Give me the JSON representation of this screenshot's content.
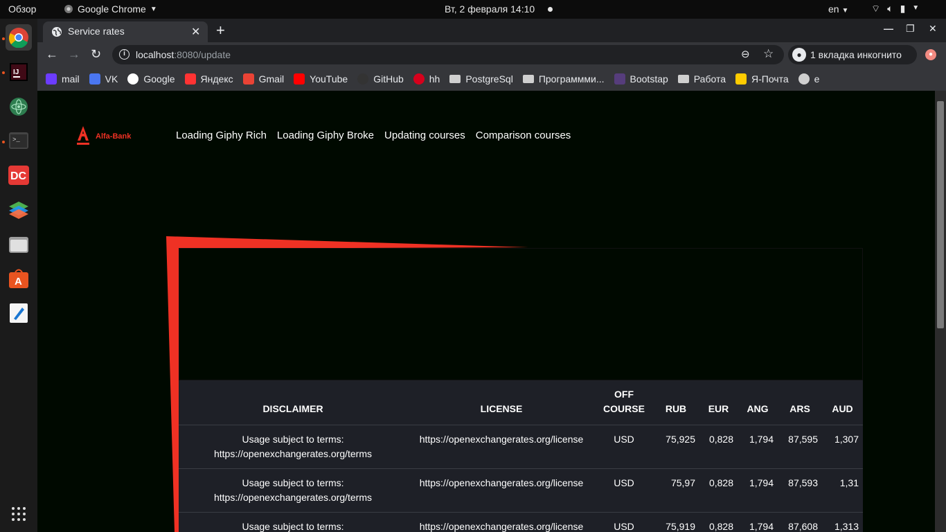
{
  "os": {
    "overview": "Обзор",
    "app_name": "Google Chrome",
    "clock": "Вт, 2 февраля  14:10",
    "lang": "en"
  },
  "browser": {
    "tab_title": "Service rates",
    "url_host": "localhost",
    "url_rest": ":8080/update",
    "incognito_label": "1 вкладка инкогнито",
    "bookmarks": [
      {
        "label": "mail",
        "icon": "at-icon",
        "color": "#6c3cff"
      },
      {
        "label": "VK",
        "icon": "vk-icon",
        "color": "#4a76f0"
      },
      {
        "label": "Google",
        "icon": "google-icon",
        "color": "#ffffff"
      },
      {
        "label": "Яндекс",
        "icon": "yandex-icon",
        "color": "#f33"
      },
      {
        "label": "Gmail",
        "icon": "gmail-icon",
        "color": "#ea4335"
      },
      {
        "label": "YouTube",
        "icon": "youtube-icon",
        "color": "#ff0000"
      },
      {
        "label": "GitHub",
        "icon": "github-icon",
        "color": "#333"
      },
      {
        "label": "hh",
        "icon": "hh-icon",
        "color": "#d6001c"
      },
      {
        "label": "PostgreSql",
        "icon": "folder-icon",
        "color": "#cfcfcf"
      },
      {
        "label": "Программми...",
        "icon": "folder-icon",
        "color": "#cfcfcf"
      },
      {
        "label": "Bootstap",
        "icon": "bootstrap-icon",
        "color": "#563d7c"
      },
      {
        "label": "Работа",
        "icon": "folder-icon",
        "color": "#cfcfcf"
      },
      {
        "label": "Я-Почта",
        "icon": "mail-icon",
        "color": "#ffcc00"
      },
      {
        "label": "e",
        "icon": "globe-icon",
        "color": "#cfcfcf"
      }
    ]
  },
  "page": {
    "brand": "Alfa-Bank",
    "nav": [
      "Loading Giphy Rich",
      "Loading Giphy Broke",
      "Updating courses",
      "Comparison courses"
    ],
    "accent": "#ef3124",
    "table": {
      "headers": [
        "DISCLAIMER",
        "LICENSE",
        "OFF COURSE",
        "RUB",
        "EUR",
        "ANG",
        "ARS",
        "AUD"
      ],
      "rows": [
        [
          "Usage subject to terms: https://openexchangerates.org/terms",
          "https://openexchangerates.org/license",
          "USD",
          "75,925",
          "0,828",
          "1,794",
          "87,595",
          "1,307"
        ],
        [
          "Usage subject to terms: https://openexchangerates.org/terms",
          "https://openexchangerates.org/license",
          "USD",
          "75,97",
          "0,828",
          "1,794",
          "87,593",
          "1,31"
        ],
        [
          "Usage subject to terms:",
          "https://openexchangerates.org/license",
          "USD",
          "75,919",
          "0,828",
          "1,794",
          "87,608",
          "1,313"
        ]
      ]
    }
  }
}
